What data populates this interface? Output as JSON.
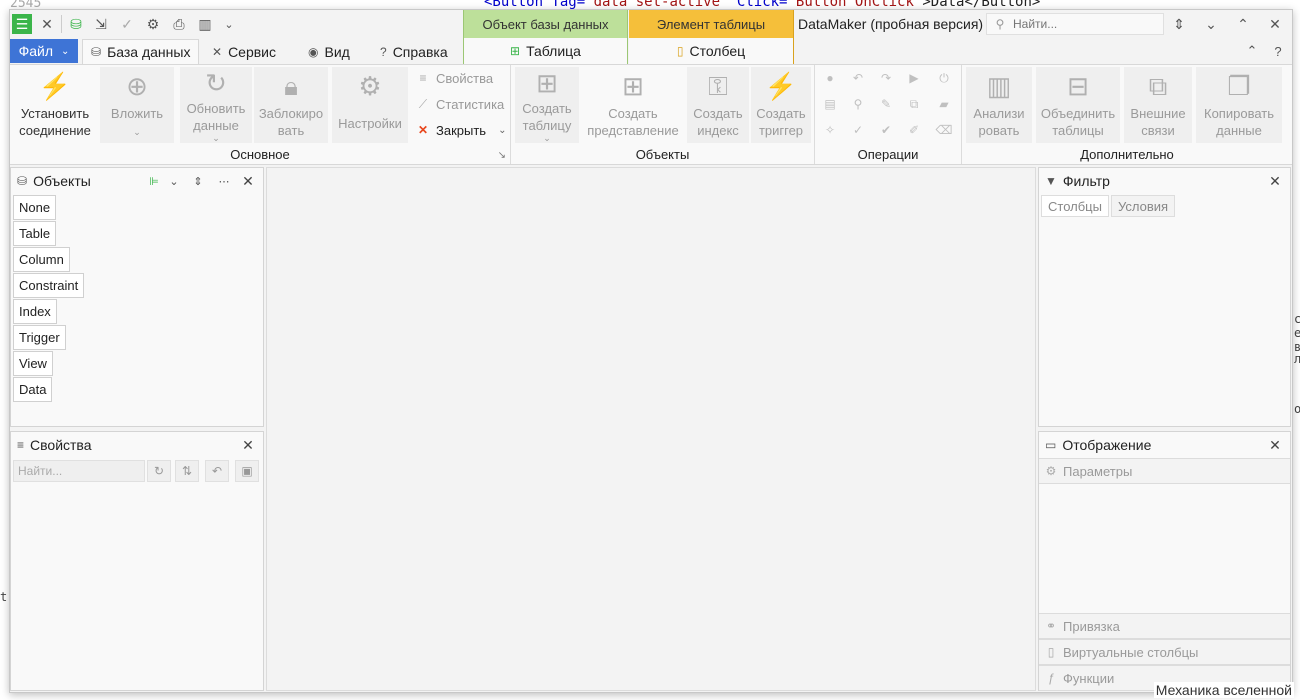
{
  "background": {
    "line_number": "2545",
    "code_tag": "<Button",
    "code_attr1": "Tag=",
    "code_val1": "\"data_set-active\"",
    "code_attr2": "Click=",
    "code_val2": "\"Button_OnClick\"",
    "code_text": ">Data</Button>",
    "right_fragments": [
      "с",
      "е",
      "в",
      "ль",
      "о"
    ],
    "left_fragment": "t",
    "bottom_text": "Механика вселенной"
  },
  "titlebar": {
    "contextual_tab_object": "Объект базы данных",
    "contextual_tab_element": "Элемент таблицы",
    "app_title": "DataMaker (пробная версия)",
    "search_placeholder": "Найти..."
  },
  "tabs": {
    "file": "Файл",
    "items": [
      "База данных",
      "Сервис",
      "Вид",
      "Справка"
    ],
    "contextual_table": "Таблица",
    "contextual_column": "Столбец"
  },
  "ribbon": {
    "groups": {
      "main": "Основное",
      "objects": "Объекты",
      "operations": "Операции",
      "extra": "Дополнительно"
    },
    "buttons": {
      "connect_line1": "Установить",
      "connect_line2": "соединение",
      "attach": "Вложить",
      "refresh_line1": "Обновить",
      "refresh_line2": "данные",
      "lock_line1": "Заблокиро",
      "lock_line2": "вать",
      "settings": "Настройки",
      "properties": "Свойства",
      "statistics": "Статистика",
      "close": "Закрыть",
      "create_table_line1": "Создать",
      "create_table_line2": "таблицу",
      "create_view_line1": "Создать",
      "create_view_line2": "представление",
      "create_index_line1": "Создать",
      "create_index_line2": "индекс",
      "create_trigger_line1": "Создать",
      "create_trigger_line2": "триггер",
      "analyze_line1": "Анализи",
      "analyze_line2": "ровать",
      "merge_line1": "Объединить",
      "merge_line2": "таблицы",
      "external_line1": "Внешние",
      "external_line2": "связи",
      "copy_line1": "Копировать",
      "copy_line2": "данные"
    }
  },
  "objects_panel": {
    "title": "Объекты",
    "items": [
      "None",
      "Table",
      "Column",
      "Constraint",
      "Index",
      "Trigger",
      "View",
      "Data"
    ]
  },
  "properties_panel": {
    "title": "Свойства",
    "search_placeholder": "Найти..."
  },
  "filter_panel": {
    "title": "Фильтр",
    "tabs": [
      "Столбцы",
      "Условия"
    ]
  },
  "display_panel": {
    "title": "Отображение",
    "parameters": "Параметры",
    "binding": "Привязка",
    "virtual_columns": "Виртуальные столбцы",
    "functions": "Функции"
  }
}
